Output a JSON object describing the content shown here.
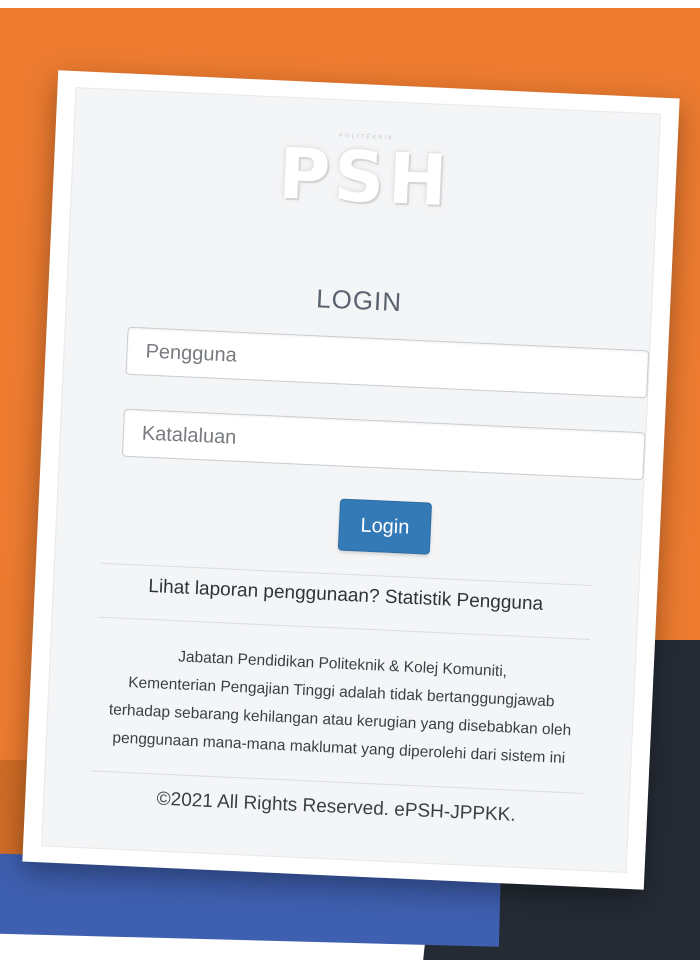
{
  "logo": {
    "top_text": "POLITEKNIK",
    "main_text": "PSH"
  },
  "form": {
    "title": "LOGIN",
    "username_placeholder": "Pengguna",
    "password_placeholder": "Katalaluan",
    "login_button_label": "Login"
  },
  "links": {
    "stats_link_text": "Lihat laporan penggunaan? Statistik Pengguna"
  },
  "footer": {
    "disclaimer_line1": "Jabatan Pendidikan Politeknik & Kolej Komuniti,",
    "disclaimer_line2": "Kementerian Pengajian Tinggi adalah tidak bertanggungjawab",
    "disclaimer_line3": "terhadap sebarang kehilangan atau kerugian yang disebabkan oleh",
    "disclaimer_line4": "penggunaan mana-mana maklumat yang diperolehi dari sistem ini",
    "copyright": "©2021 All Rights Reserved. ePSH-JPPKK."
  },
  "colors": {
    "background_orange": "#ec7b30",
    "background_dark": "#252b35",
    "background_blue": "#3f5fb0",
    "button_blue": "#337ab7"
  },
  "icons": {
    "logo": "psh-logo"
  }
}
